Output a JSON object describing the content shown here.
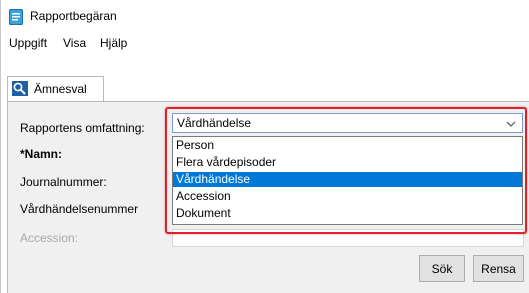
{
  "window": {
    "title": "Rapportbegäran"
  },
  "menu": {
    "items": [
      "Uppgift",
      "Visa",
      "Hjälp"
    ]
  },
  "tab": {
    "label": "Ämnesval"
  },
  "form": {
    "scope_label": "Rapportens omfattning:",
    "name_label": "*Namn:",
    "journal_label": "Journalnummer:",
    "event_number_label": "Vårdhändelsenummer",
    "accession_label": "Accession:"
  },
  "combo": {
    "value": "Vårdhändelse",
    "options": [
      "Person",
      "Flera vårdepisoder",
      "Vårdhändelse",
      "Accession",
      "Dokument"
    ],
    "selected_index": 2
  },
  "buttons": {
    "search_label": "Sök",
    "clear_label": "Rensa"
  },
  "colors": {
    "selection": "#0078d7",
    "highlight": "#e0202a",
    "panel": "#f0f0f0"
  },
  "icons": {
    "app": "document-icon",
    "tab": "search-person-icon",
    "combo": "chevron-down-icon"
  }
}
